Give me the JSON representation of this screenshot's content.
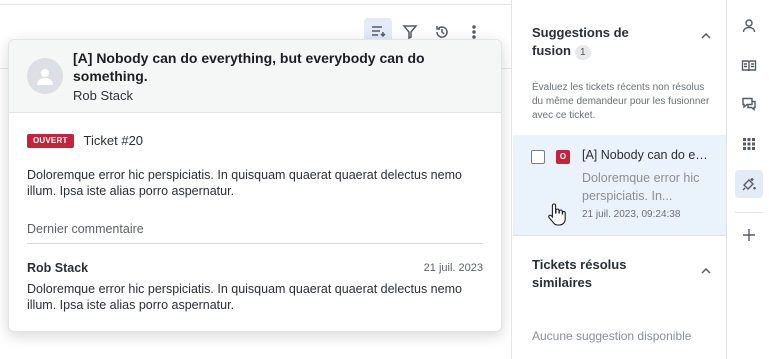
{
  "ticket_popover": {
    "title": "[A] Nobody can do everything, but everybody can do something.",
    "author": "Rob Stack",
    "status_badge": "OUVERT",
    "ticket_number": "Ticket #20",
    "description": "Doloremque error hic perspiciatis. In quisquam quaerat quaerat delectus nemo illum. Ipsa iste alias porro aspernatur.",
    "last_comment_label": "Dernier commentaire",
    "comment": {
      "author": "Rob Stack",
      "date": "21 juil. 2023",
      "text": "Doloremque error hic perspiciatis. In quisquam quaerat quaerat delectus nemo illum. Ipsa iste alias porro aspernatur."
    }
  },
  "toolbar": {
    "icons": [
      "list-settings-icon",
      "filter-icon",
      "history-icon",
      "more-vertical-icon"
    ]
  },
  "merge_suggestions": {
    "title": "Suggestions de fusion",
    "count": "1",
    "hint": "Évaluez les tickets récents non résolus du même demandeur pour les fusionner avec ce ticket.",
    "item": {
      "badge": "O",
      "title": "[A] Nobody can do everything, but everybody can do something.",
      "description": "Doloremque error hic perspiciatis. In...",
      "date": "21 juil. 2023, 09:24:38"
    }
  },
  "similar_tickets": {
    "title": "Tickets résolus similaires",
    "empty": "Aucune suggestion disponible"
  },
  "rail": {
    "icons": [
      "user-icon",
      "book-icon",
      "conversation-icon",
      "apps-grid-icon",
      "merge-sparkle-icon",
      "add-icon"
    ]
  },
  "colors": {
    "status_open": "#c4233a",
    "active_highlight": "#e3ebf6",
    "suggestion_bg": "#eaf2fb"
  }
}
